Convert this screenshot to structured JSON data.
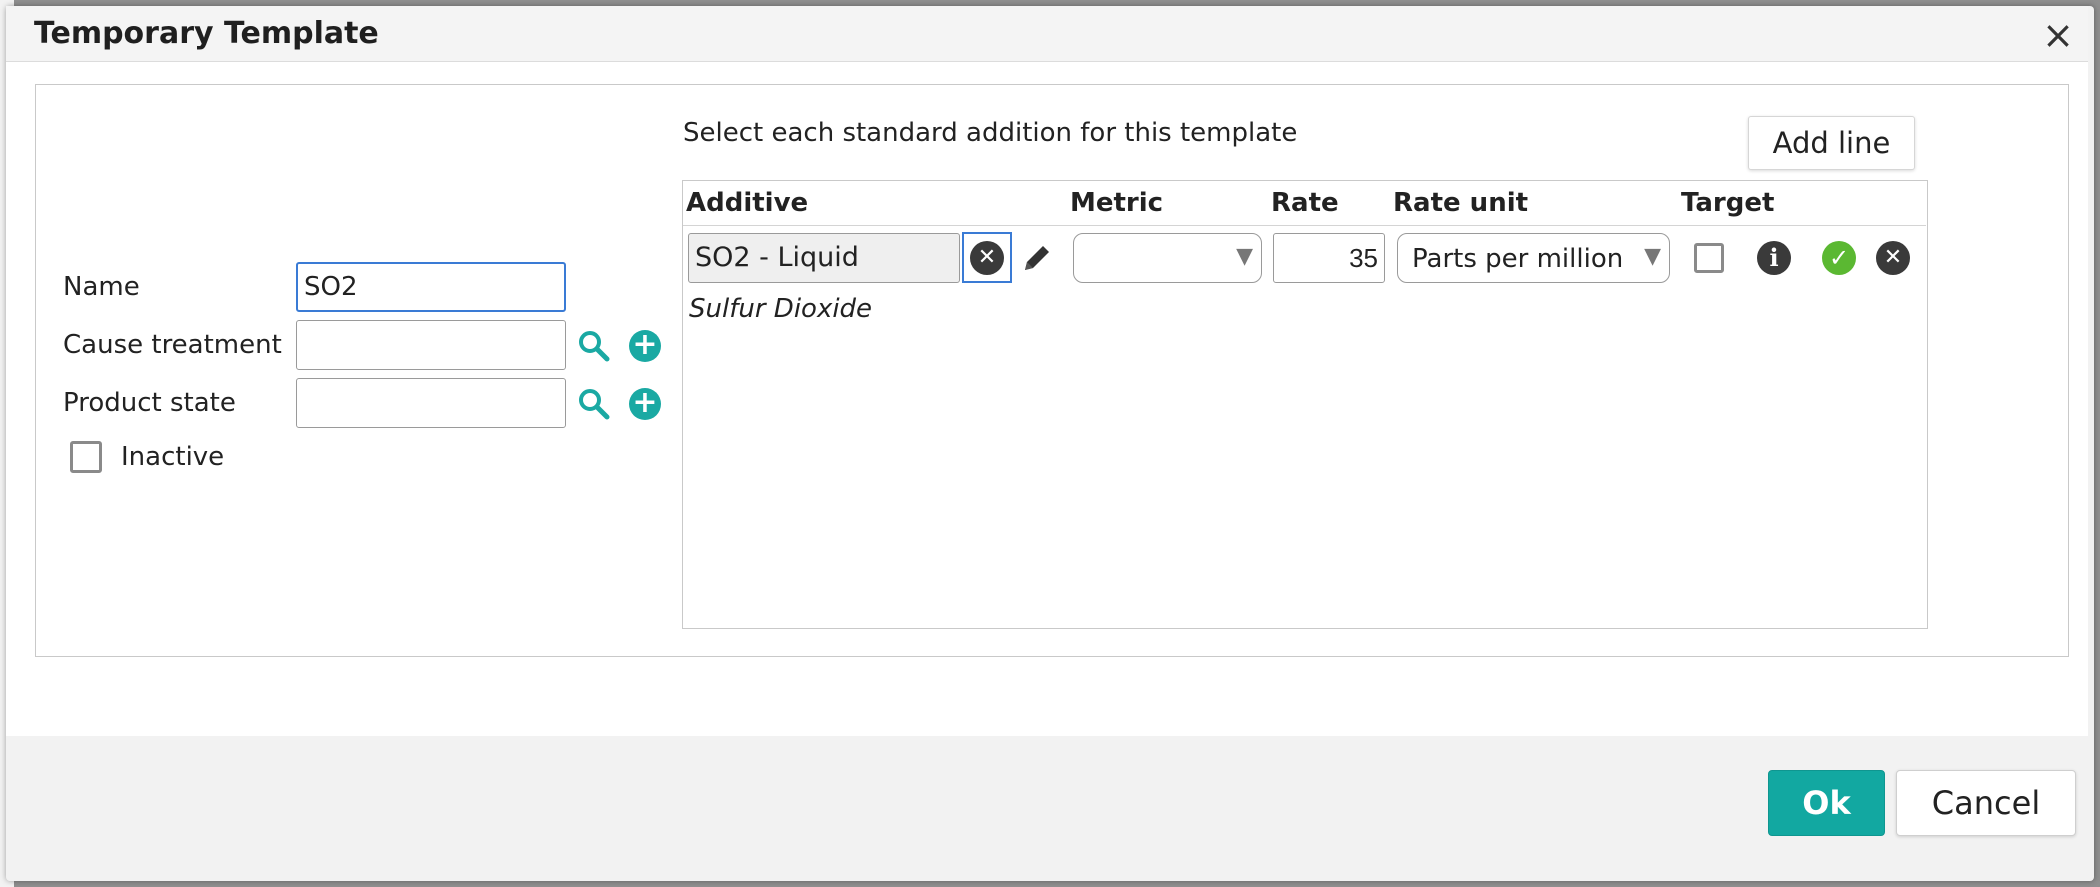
{
  "dialog": {
    "title": "Temporary Template",
    "close_glyph": "×"
  },
  "form": {
    "name_label": "Name",
    "name_value": "SO2",
    "cause_treatment_label": "Cause treatment",
    "cause_treatment_value": "",
    "product_state_label": "Product state",
    "product_state_value": "",
    "inactive_label": "Inactive",
    "inactive_checked": false
  },
  "additions": {
    "section_title": "Select each standard addition for this template",
    "add_line_label": "Add line",
    "columns": [
      "Additive",
      "Metric",
      "Rate",
      "Rate unit",
      "Target"
    ],
    "rows": [
      {
        "additive": "SO2 - Liquid",
        "additive_description": "Sulfur Dioxide",
        "metric": "",
        "rate": "35",
        "rate_unit": "Parts per million",
        "target_checked": false
      }
    ]
  },
  "footer": {
    "ok_label": "Ok",
    "cancel_label": "Cancel"
  },
  "colors": {
    "accent": "#12a8a1",
    "focus": "#3a7bd5",
    "confirm_green": "#5bb832",
    "dark_icon": "#3a3a3a"
  },
  "icons": [
    "close-icon",
    "search-icon",
    "plus-circle-icon",
    "clear-circle-icon",
    "pencil-icon",
    "chevron-down-icon",
    "info-icon",
    "check-circle-icon",
    "cancel-circle-icon"
  ]
}
